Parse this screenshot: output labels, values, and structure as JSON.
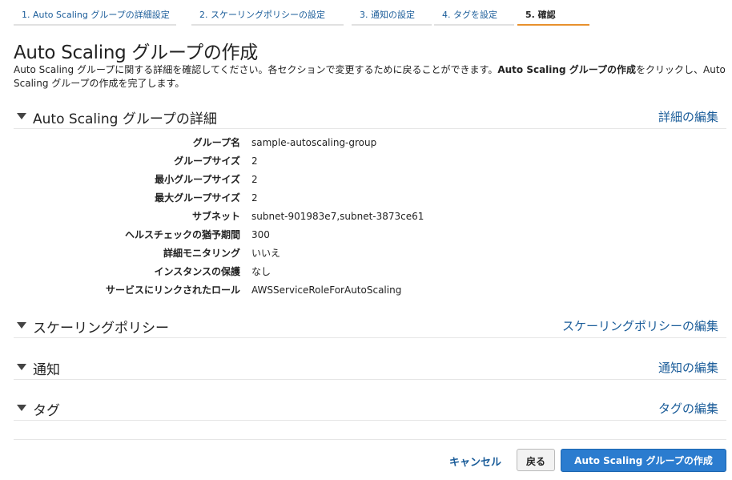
{
  "wizard": {
    "steps": [
      {
        "label": "1. Auto Scaling グループの詳細設定"
      },
      {
        "label": "2. スケーリングポリシーの設定"
      },
      {
        "label": "3. 通知の設定"
      },
      {
        "label": "4. タグを設定"
      },
      {
        "label": "5. 確認"
      }
    ],
    "active_step": 5
  },
  "page": {
    "title": "Auto Scaling グループの作成",
    "intro_part1": "Auto Scaling グループに関する詳細を確認してください。各セクションで変更するために戻ることができます。",
    "intro_bold": "Auto Scaling グループの作成",
    "intro_part2": "をクリックし、Auto Scaling グループの作成を完了します。"
  },
  "sections": {
    "details": {
      "title": "Auto Scaling グループの詳細",
      "edit_label": "詳細の編集",
      "fields": [
        {
          "label": "グループ名",
          "value": "sample-autoscaling-group"
        },
        {
          "label": "グループサイズ",
          "value": "2"
        },
        {
          "label": "最小グループサイズ",
          "value": "2"
        },
        {
          "label": "最大グループサイズ",
          "value": "2"
        },
        {
          "label": "サブネット",
          "value": "subnet-901983e7,subnet-3873ce61"
        },
        {
          "label": "ヘルスチェックの猶予期間",
          "value": "300"
        },
        {
          "label": "詳細モニタリング",
          "value": "いいえ"
        },
        {
          "label": "インスタンスの保護",
          "value": "なし"
        },
        {
          "label": "サービスにリンクされたロール",
          "value": "AWSServiceRoleForAutoScaling"
        }
      ]
    },
    "scaling_policy": {
      "title": "スケーリングポリシー",
      "edit_label": "スケーリングポリシーの編集"
    },
    "notifications": {
      "title": "通知",
      "edit_label": "通知の編集"
    },
    "tags": {
      "title": "タグ",
      "edit_label": "タグの編集"
    }
  },
  "footer": {
    "cancel_label": "キャンセル",
    "back_label": "戻る",
    "create_label": "Auto Scaling グループの作成"
  },
  "colors": {
    "link": "#1a5c99",
    "primary_button": "#2b7ccf",
    "active_step_underline": "#e8912d"
  }
}
